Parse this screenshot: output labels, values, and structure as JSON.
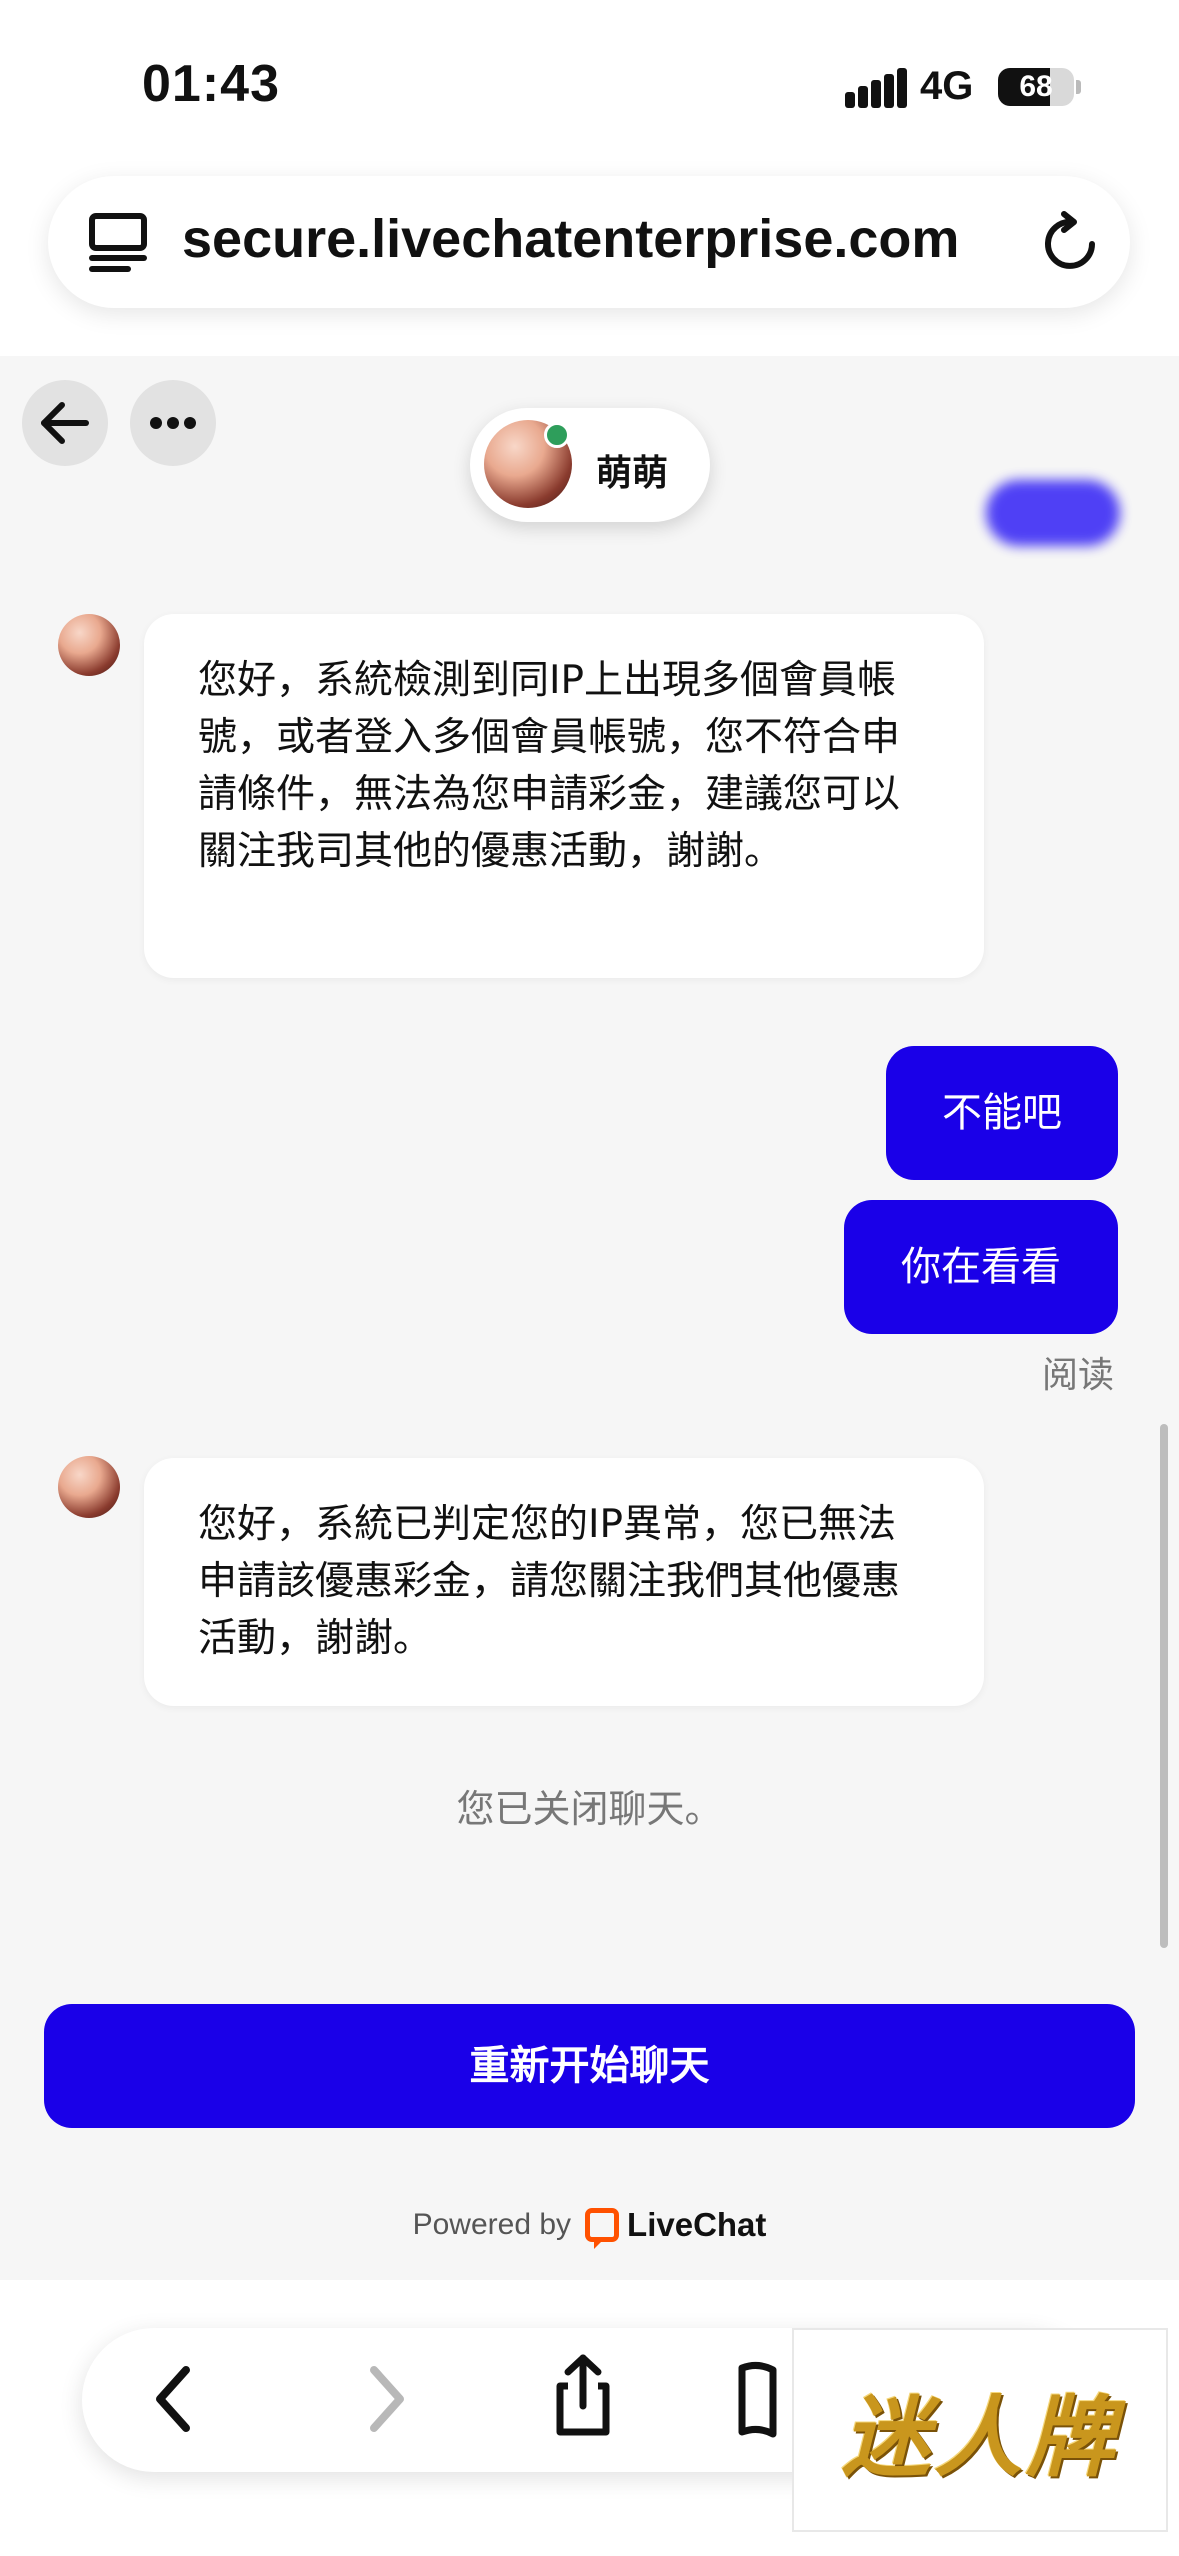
{
  "status_bar": {
    "time": "01:43",
    "network": "4G",
    "battery": "68",
    "battery_level": 0.68
  },
  "url_bar": {
    "url": "secure.livechatenterprise.com",
    "icons": [
      "tabs-icon",
      "reload-icon"
    ]
  },
  "chat_header": {
    "agent_name": "萌萌",
    "status": "online"
  },
  "messages": [
    {
      "from": "agent",
      "text": "您好，系統檢測到同IP上出現多個會員帳號，或者登入多個會員帳號，您不符合申請條件，無法為您申請彩金，建議您可以關注我司其他的優惠活動，謝謝。"
    },
    {
      "from": "user",
      "text": "不能吧"
    },
    {
      "from": "user",
      "text": "你在看看"
    },
    {
      "from": "agent",
      "text": "您好，系統已判定您的IP異常，您已無法申請該優惠彩金，請您關注我們其他優惠活動，謝謝。"
    }
  ],
  "read_receipt": "阅读",
  "chat_closed_notice": "您已关闭聊天。",
  "restart_button": "重新开始聊天",
  "footer": {
    "powered_by": "Powered by",
    "brand": "LiveChat"
  },
  "watermark": "迷人牌",
  "colors": {
    "accent": "#1a00e8",
    "online": "#2e9e5b",
    "livechat_orange": "#ff5100"
  }
}
